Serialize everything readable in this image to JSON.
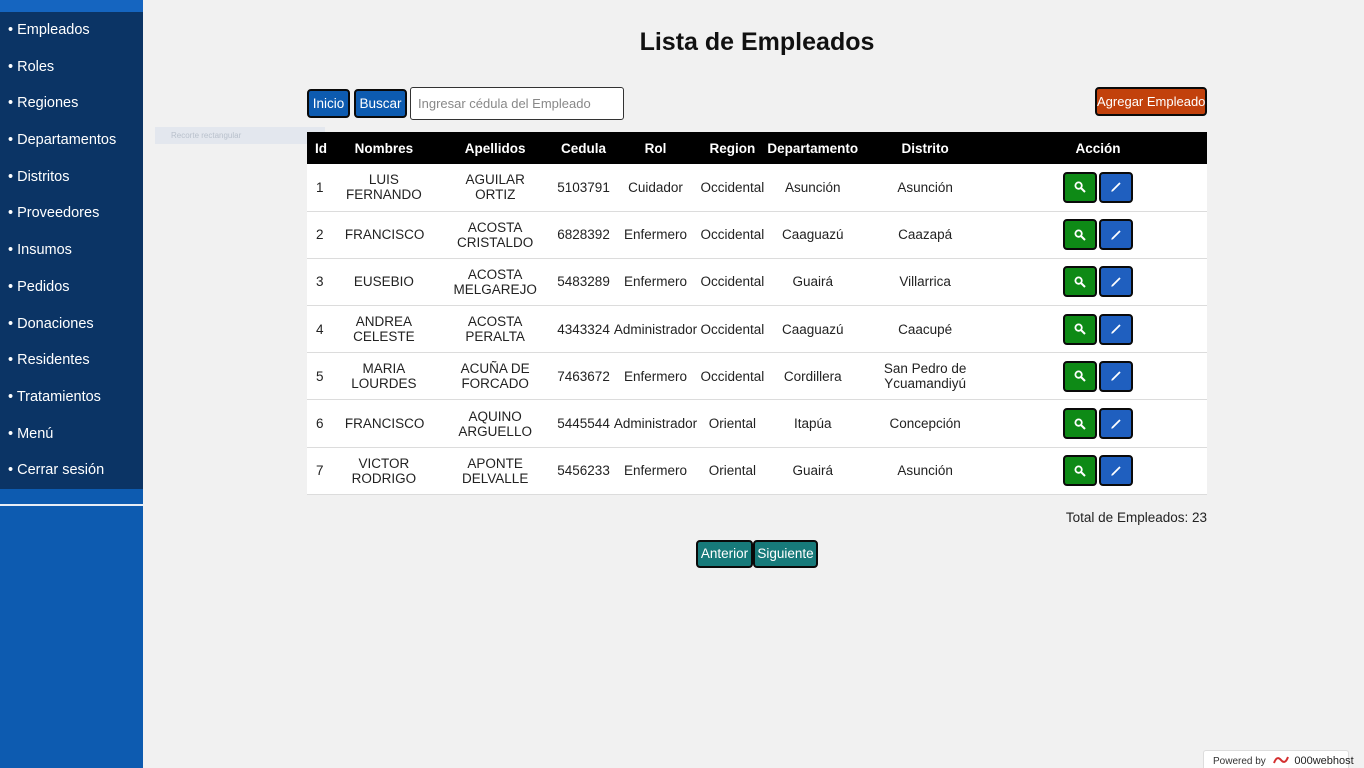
{
  "sidebar": {
    "items": [
      {
        "label": "• Empleados"
      },
      {
        "label": "• Roles"
      },
      {
        "label": "• Regiones"
      },
      {
        "label": "• Departamentos"
      },
      {
        "label": "• Distritos"
      },
      {
        "label": "• Proveedores"
      },
      {
        "label": "• Insumos"
      },
      {
        "label": "• Pedidos"
      },
      {
        "label": "• Donaciones"
      },
      {
        "label": "• Residentes"
      },
      {
        "label": "• Tratamientos"
      },
      {
        "label": "• Menú"
      },
      {
        "label": "• Cerrar sesión"
      }
    ]
  },
  "ghost_tooltip": "Recorte rectangular",
  "page": {
    "title": "Lista de Empleados"
  },
  "toolbar": {
    "inicio_label": "Inicio",
    "buscar_label": "Buscar",
    "search_placeholder": "Ingresar cédula del Empleado",
    "search_value": "",
    "agregar_label": "Agregar Empleado"
  },
  "table": {
    "headers": [
      "Id",
      "Nombres",
      "Apellidos",
      "Cedula",
      "Rol",
      "Region",
      "Departamento",
      "Distrito",
      "Acción"
    ],
    "rows": [
      {
        "id": "1",
        "nombres": "LUIS FERNANDO",
        "apellidos": "AGUILAR ORTIZ",
        "cedula": "5103791",
        "rol": "Cuidador",
        "region": "Occidental",
        "departamento": "Asunción",
        "distrito": "Asunción"
      },
      {
        "id": "2",
        "nombres": "FRANCISCO",
        "apellidos": "ACOSTA CRISTALDO",
        "cedula": "6828392",
        "rol": "Enfermero",
        "region": "Occidental",
        "departamento": "Caaguazú",
        "distrito": "Caazapá"
      },
      {
        "id": "3",
        "nombres": "EUSEBIO",
        "apellidos": "ACOSTA MELGAREJO",
        "cedula": "5483289",
        "rol": "Enfermero",
        "region": "Occidental",
        "departamento": "Guairá",
        "distrito": "Villarrica"
      },
      {
        "id": "4",
        "nombres": "ANDREA CELESTE",
        "apellidos": "ACOSTA PERALTA",
        "cedula": "4343324",
        "rol": "Administrador",
        "region": "Occidental",
        "departamento": "Caaguazú",
        "distrito": "Caacupé"
      },
      {
        "id": "5",
        "nombres": "MARIA LOURDES",
        "apellidos": "ACUÑA DE FORCADO",
        "cedula": "7463672",
        "rol": "Enfermero",
        "region": "Occidental",
        "departamento": "Cordillera",
        "distrito": "San Pedro de Ycuamandiyú"
      },
      {
        "id": "6",
        "nombres": "FRANCISCO",
        "apellidos": "AQUINO ARGUELLO",
        "cedula": "5445544",
        "rol": "Administrador",
        "region": "Oriental",
        "departamento": "Itapúa",
        "distrito": "Concepción"
      },
      {
        "id": "7",
        "nombres": "VICTOR RODRIGO",
        "apellidos": "APONTE DELVALLE",
        "cedula": "5456233",
        "rol": "Enfermero",
        "region": "Oriental",
        "departamento": "Guairá",
        "distrito": "Asunción"
      }
    ]
  },
  "footer": {
    "total_label": "Total de Empleados: 23",
    "anterior_label": "Anterior",
    "siguiente_label": "Siguiente"
  },
  "powered": {
    "prefix": "Powered by",
    "brand": "000webhost"
  },
  "colors": {
    "sidebar_menu": "#0b3465",
    "sidebar_bg": "#0d5bb0",
    "primary_button": "#0d5bb0",
    "add_button": "#c2410c",
    "view_button": "#0e8a16",
    "edit_button": "#1f5fbf",
    "pager_button": "#177a7a"
  },
  "icons": {
    "view": "search-icon",
    "edit": "pencil-icon",
    "brand": "000webhost-logo-icon"
  }
}
